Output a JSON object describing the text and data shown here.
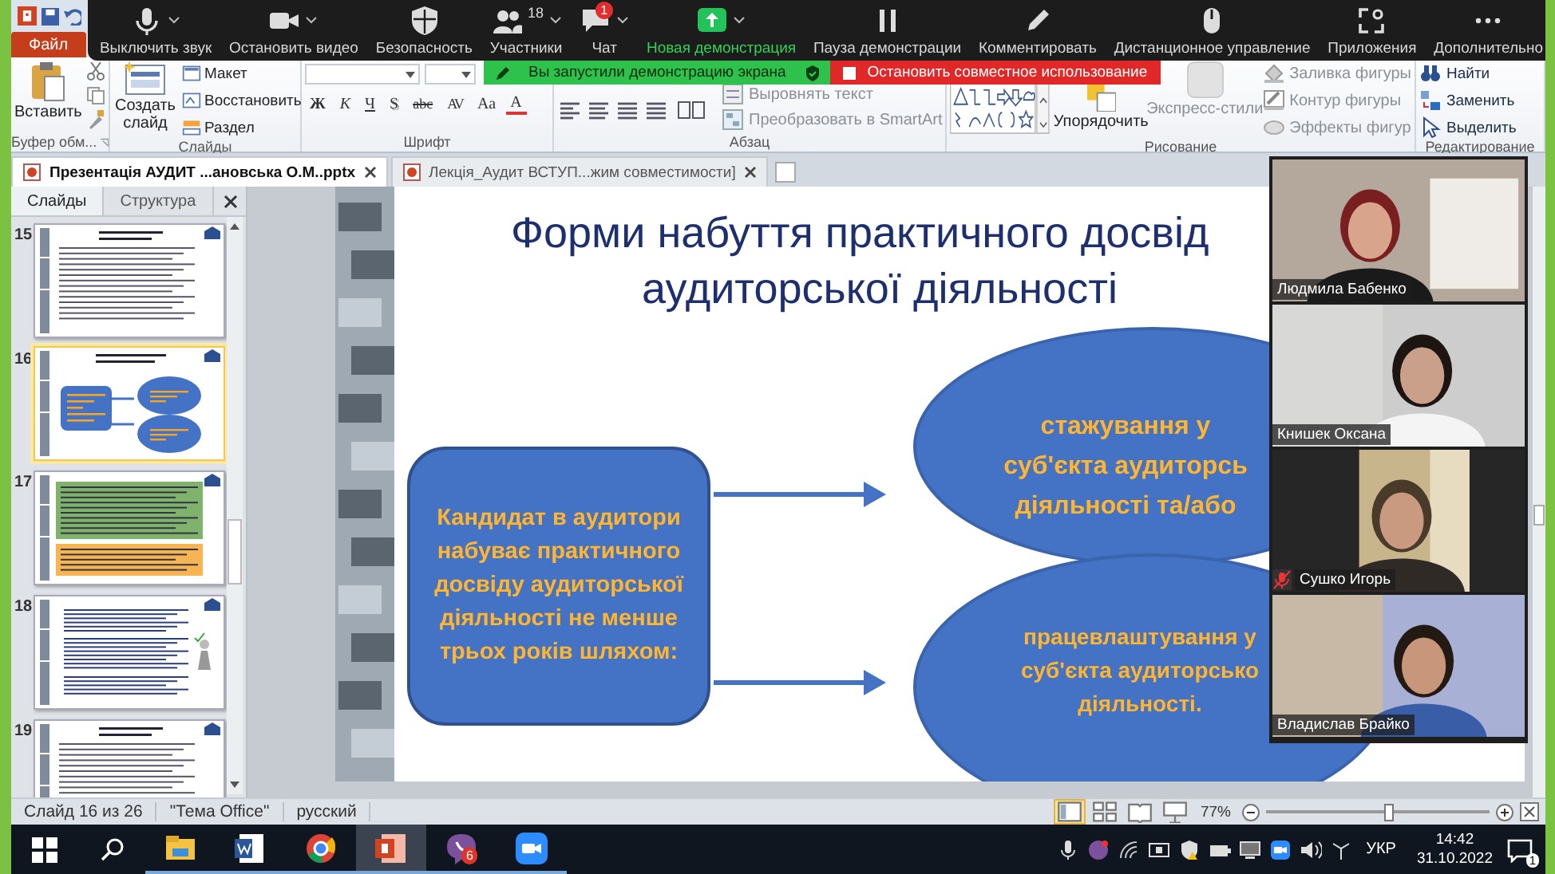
{
  "ppt_titlebar": {
    "file_tab": "Файл"
  },
  "zoom_toolbar": {
    "items": [
      {
        "label": "Выключить звук",
        "caret": true,
        "active": false
      },
      {
        "label": "Остановить видео",
        "caret": true,
        "active": false
      },
      {
        "label": "Безопасность",
        "caret": false,
        "active": false
      },
      {
        "label": "Участники",
        "count": "18",
        "caret": true,
        "active": false
      },
      {
        "label": "Чат",
        "badge": "1",
        "caret": true,
        "active": false
      },
      {
        "label": "Новая демонстрация",
        "caret": true,
        "active": true
      },
      {
        "label": "Пауза демонстрации",
        "caret": false,
        "active": false
      },
      {
        "label": "Комментировать",
        "caret": false,
        "active": false
      },
      {
        "label": "Дистанционное управление",
        "caret": false,
        "active": false
      },
      {
        "label": "Приложения",
        "caret": false,
        "active": false
      },
      {
        "label": "Дополнительно",
        "caret": false,
        "active": false
      }
    ]
  },
  "share_banner": {
    "message": "Вы запустили демонстрацию экрана",
    "stop_button": "Остановить совместное использование"
  },
  "ribbon": {
    "clipboard": {
      "title": "Буфер обм...",
      "paste": "Вставить"
    },
    "slides": {
      "title": "Слайды",
      "new_slide": "Создать слайд",
      "items": [
        "Макет",
        "Восстановить",
        "Раздел"
      ]
    },
    "font": {
      "title": "Шрифт",
      "buttons": [
        "Ж",
        "К",
        "Ч",
        "S",
        "abc",
        "AV",
        "Aa",
        "A"
      ]
    },
    "paragraph": {
      "title": "Абзац",
      "items": [
        {
          "label": "Выровнять текст",
          "disabled": true
        },
        {
          "label": "Преобразовать в SmartArt",
          "disabled": true
        }
      ]
    },
    "drawing": {
      "title": "Рисование",
      "arrange": "Упорядочить",
      "quick_styles": {
        "label": "Экспресс-стили",
        "disabled": true
      },
      "items": [
        {
          "label": "Заливка фигуры",
          "disabled": true
        },
        {
          "label": "Контур фигуры",
          "disabled": true
        },
        {
          "label": "Эффекты фигур",
          "disabled": true
        }
      ]
    },
    "editing": {
      "title": "Редактирование",
      "items": [
        "Найти",
        "Заменить",
        "Выделить"
      ]
    }
  },
  "document_tabs": [
    {
      "label": "Презентація АУДИТ ...ановська О.М..pptx",
      "selected": true
    },
    {
      "label": "Лекція_Аудит ВСТУП...жим совместимости]",
      "selected": false
    }
  ],
  "slide_panel": {
    "tabs": [
      {
        "label": "Слайды",
        "selected": true
      },
      {
        "label": "Структура",
        "selected": false
      }
    ],
    "thumbnails": [
      {
        "number": "15",
        "kind": "text",
        "selected": false
      },
      {
        "number": "16",
        "kind": "diagram",
        "selected": true
      },
      {
        "number": "17",
        "kind": "boxes",
        "selected": false
      },
      {
        "number": "18",
        "kind": "figure",
        "selected": false
      },
      {
        "number": "19",
        "kind": "text",
        "selected": false
      }
    ]
  },
  "slide": {
    "title": [
      "Форми набуття практичного досвід",
      "аудиторської діяльності"
    ],
    "box": "Кандидат в аудитори набуває практичного досвіду аудиторської діяльності не менше трьох років шляхом:",
    "ellipses": [
      {
        "lines": [
          "стажування у",
          "суб'єкта аудиторсь",
          "діяльності та/або"
        ]
      },
      {
        "lines": [
          "працевлаштування у",
          "суб'єкта аудиторсько",
          "діяльності."
        ]
      }
    ]
  },
  "video_tiles": [
    {
      "name": "Людмила Бабенко",
      "muted": false
    },
    {
      "name": "Книшек Оксана",
      "muted": false
    },
    {
      "name": "Сушко Игорь",
      "muted": true
    },
    {
      "name": "Владислав Брайко",
      "muted": false
    }
  ],
  "status_bar": {
    "slide": "Слайд 16 из 26",
    "theme": "\"Тема Office\"",
    "language": "русский",
    "zoom": "77%",
    "level": 0.55
  },
  "taskbar": {
    "apps": [
      {
        "kind": "explorer",
        "active": false
      },
      {
        "kind": "word",
        "active": false
      },
      {
        "kind": "chrome",
        "active": false
      },
      {
        "kind": "powerpoint",
        "active": true
      },
      {
        "kind": "viber",
        "badge": "6",
        "active": false
      },
      {
        "kind": "zoom",
        "active": false
      }
    ],
    "tray": {
      "language": "УКР",
      "time": "14:42",
      "date": "31.10.2022",
      "notifications": "1"
    }
  }
}
